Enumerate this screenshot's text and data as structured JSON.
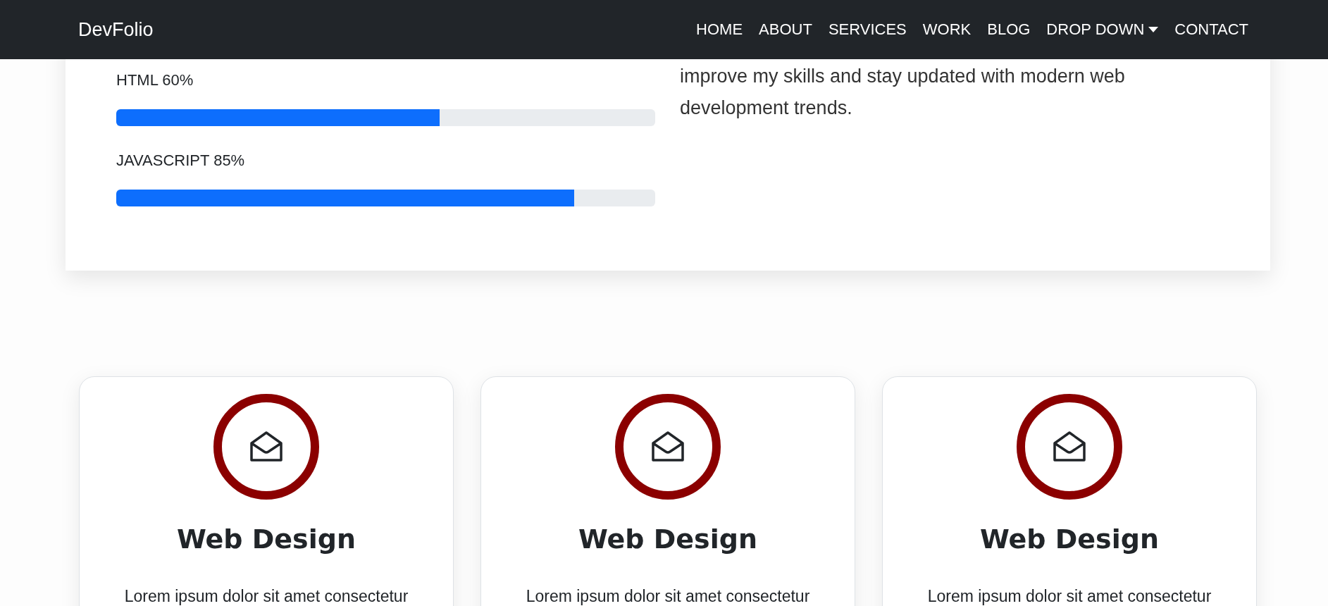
{
  "navbar": {
    "brand": "DevFolio",
    "items": [
      {
        "label": "HOME",
        "kind": "link"
      },
      {
        "label": "ABOUT",
        "kind": "link"
      },
      {
        "label": "SERVICES",
        "kind": "link"
      },
      {
        "label": "WORK",
        "kind": "link"
      },
      {
        "label": "BLOG",
        "kind": "link"
      },
      {
        "label": "DROP DOWN",
        "kind": "dropdown"
      },
      {
        "label": "CONTACT",
        "kind": "link"
      }
    ]
  },
  "about": {
    "skills": [
      {
        "label": "HTML 60%",
        "level": 0.6
      },
      {
        "label": "JAVASCRIPT 85%",
        "level": 0.85
      }
    ],
    "text": "improve my skills and stay updated with modern web development trends."
  },
  "services": [
    {
      "title": "Web Design",
      "text": "Lorem ipsum dolor sit amet consectetur"
    },
    {
      "title": "Web Design",
      "text": "Lorem ipsum dolor sit amet consectetur"
    },
    {
      "title": "Web Design",
      "text": "Lorem ipsum dolor sit amet consectetur"
    }
  ]
}
